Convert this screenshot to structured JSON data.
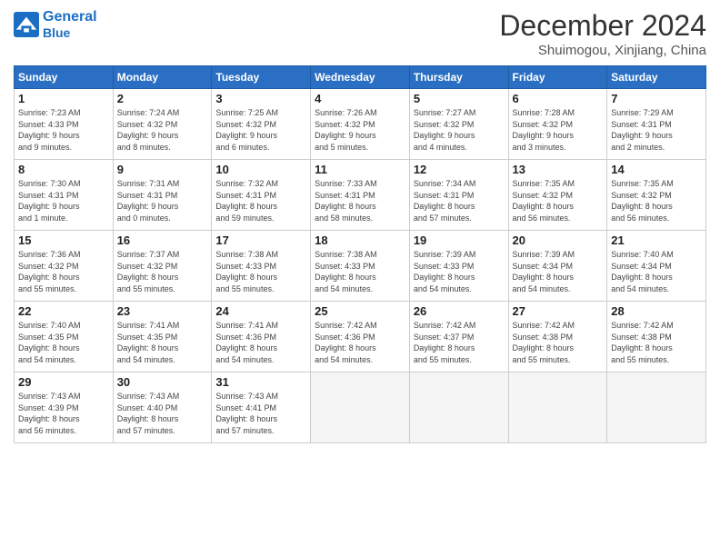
{
  "header": {
    "logo_line1": "General",
    "logo_line2": "Blue",
    "month": "December 2024",
    "location": "Shuimogou, Xinjiang, China"
  },
  "weekdays": [
    "Sunday",
    "Monday",
    "Tuesday",
    "Wednesday",
    "Thursday",
    "Friday",
    "Saturday"
  ],
  "weeks": [
    [
      {
        "day": "1",
        "info": "Sunrise: 7:23 AM\nSunset: 4:33 PM\nDaylight: 9 hours\nand 9 minutes."
      },
      {
        "day": "2",
        "info": "Sunrise: 7:24 AM\nSunset: 4:32 PM\nDaylight: 9 hours\nand 8 minutes."
      },
      {
        "day": "3",
        "info": "Sunrise: 7:25 AM\nSunset: 4:32 PM\nDaylight: 9 hours\nand 6 minutes."
      },
      {
        "day": "4",
        "info": "Sunrise: 7:26 AM\nSunset: 4:32 PM\nDaylight: 9 hours\nand 5 minutes."
      },
      {
        "day": "5",
        "info": "Sunrise: 7:27 AM\nSunset: 4:32 PM\nDaylight: 9 hours\nand 4 minutes."
      },
      {
        "day": "6",
        "info": "Sunrise: 7:28 AM\nSunset: 4:32 PM\nDaylight: 9 hours\nand 3 minutes."
      },
      {
        "day": "7",
        "info": "Sunrise: 7:29 AM\nSunset: 4:31 PM\nDaylight: 9 hours\nand 2 minutes."
      }
    ],
    [
      {
        "day": "8",
        "info": "Sunrise: 7:30 AM\nSunset: 4:31 PM\nDaylight: 9 hours\nand 1 minute."
      },
      {
        "day": "9",
        "info": "Sunrise: 7:31 AM\nSunset: 4:31 PM\nDaylight: 9 hours\nand 0 minutes."
      },
      {
        "day": "10",
        "info": "Sunrise: 7:32 AM\nSunset: 4:31 PM\nDaylight: 8 hours\nand 59 minutes."
      },
      {
        "day": "11",
        "info": "Sunrise: 7:33 AM\nSunset: 4:31 PM\nDaylight: 8 hours\nand 58 minutes."
      },
      {
        "day": "12",
        "info": "Sunrise: 7:34 AM\nSunset: 4:31 PM\nDaylight: 8 hours\nand 57 minutes."
      },
      {
        "day": "13",
        "info": "Sunrise: 7:35 AM\nSunset: 4:32 PM\nDaylight: 8 hours\nand 56 minutes."
      },
      {
        "day": "14",
        "info": "Sunrise: 7:35 AM\nSunset: 4:32 PM\nDaylight: 8 hours\nand 56 minutes."
      }
    ],
    [
      {
        "day": "15",
        "info": "Sunrise: 7:36 AM\nSunset: 4:32 PM\nDaylight: 8 hours\nand 55 minutes."
      },
      {
        "day": "16",
        "info": "Sunrise: 7:37 AM\nSunset: 4:32 PM\nDaylight: 8 hours\nand 55 minutes."
      },
      {
        "day": "17",
        "info": "Sunrise: 7:38 AM\nSunset: 4:33 PM\nDaylight: 8 hours\nand 55 minutes."
      },
      {
        "day": "18",
        "info": "Sunrise: 7:38 AM\nSunset: 4:33 PM\nDaylight: 8 hours\nand 54 minutes."
      },
      {
        "day": "19",
        "info": "Sunrise: 7:39 AM\nSunset: 4:33 PM\nDaylight: 8 hours\nand 54 minutes."
      },
      {
        "day": "20",
        "info": "Sunrise: 7:39 AM\nSunset: 4:34 PM\nDaylight: 8 hours\nand 54 minutes."
      },
      {
        "day": "21",
        "info": "Sunrise: 7:40 AM\nSunset: 4:34 PM\nDaylight: 8 hours\nand 54 minutes."
      }
    ],
    [
      {
        "day": "22",
        "info": "Sunrise: 7:40 AM\nSunset: 4:35 PM\nDaylight: 8 hours\nand 54 minutes."
      },
      {
        "day": "23",
        "info": "Sunrise: 7:41 AM\nSunset: 4:35 PM\nDaylight: 8 hours\nand 54 minutes."
      },
      {
        "day": "24",
        "info": "Sunrise: 7:41 AM\nSunset: 4:36 PM\nDaylight: 8 hours\nand 54 minutes."
      },
      {
        "day": "25",
        "info": "Sunrise: 7:42 AM\nSunset: 4:36 PM\nDaylight: 8 hours\nand 54 minutes."
      },
      {
        "day": "26",
        "info": "Sunrise: 7:42 AM\nSunset: 4:37 PM\nDaylight: 8 hours\nand 55 minutes."
      },
      {
        "day": "27",
        "info": "Sunrise: 7:42 AM\nSunset: 4:38 PM\nDaylight: 8 hours\nand 55 minutes."
      },
      {
        "day": "28",
        "info": "Sunrise: 7:42 AM\nSunset: 4:38 PM\nDaylight: 8 hours\nand 55 minutes."
      }
    ],
    [
      {
        "day": "29",
        "info": "Sunrise: 7:43 AM\nSunset: 4:39 PM\nDaylight: 8 hours\nand 56 minutes."
      },
      {
        "day": "30",
        "info": "Sunrise: 7:43 AM\nSunset: 4:40 PM\nDaylight: 8 hours\nand 57 minutes."
      },
      {
        "day": "31",
        "info": "Sunrise: 7:43 AM\nSunset: 4:41 PM\nDaylight: 8 hours\nand 57 minutes."
      },
      {
        "day": "",
        "info": ""
      },
      {
        "day": "",
        "info": ""
      },
      {
        "day": "",
        "info": ""
      },
      {
        "day": "",
        "info": ""
      }
    ]
  ]
}
